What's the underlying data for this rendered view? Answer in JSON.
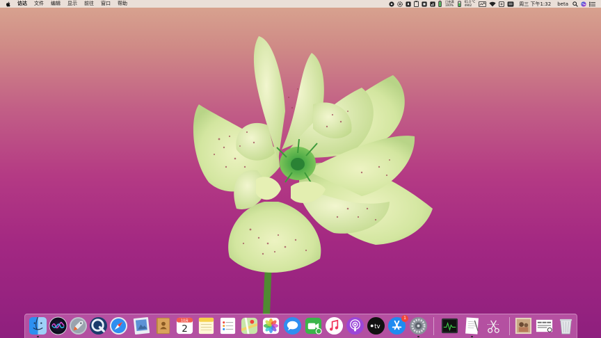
{
  "menubar": {
    "items": [
      "访达",
      "文件",
      "编辑",
      "显示",
      "前往",
      "窗口",
      "帮助"
    ],
    "status": {
      "battery_line1": "已充满",
      "battery_line2": "100%",
      "temp_line1": "61.0 °C",
      "temp_line2": "4902",
      "datetime": "周三 下午1:32",
      "beta_label": "beta"
    }
  },
  "dock": {
    "calendar": {
      "month": "10月",
      "day": "2"
    },
    "appstore_badge": "1",
    "tv_label": "tv"
  }
}
